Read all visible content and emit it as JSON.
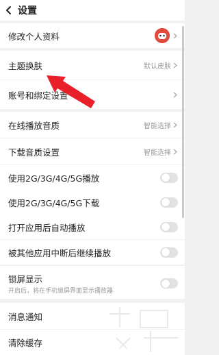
{
  "header": {
    "title": "设置",
    "back_icon": "back-arrow-icon"
  },
  "rows": [
    {
      "label": "修改个人资料",
      "value": "",
      "type": "avatar"
    },
    {
      "label": "主题换肤",
      "value": "默认皮肤",
      "type": "chevron"
    },
    {
      "label": "账号和绑定设置",
      "value": "",
      "type": "chevron"
    },
    {
      "label": "在线播放音质",
      "value": "智能选择",
      "type": "chevron"
    },
    {
      "label": "下载音质设置",
      "value": "智能选择",
      "type": "chevron"
    },
    {
      "label": "使用2G/3G/4G/5G播放",
      "value": "",
      "type": "toggle",
      "on": false
    },
    {
      "label": "使用2G/3G/4G/5G下载",
      "value": "",
      "type": "toggle",
      "on": false
    },
    {
      "label": "打开应用后自动播放",
      "value": "",
      "type": "toggle",
      "on": false
    },
    {
      "label": "被其他应用中断后继续播放",
      "value": "",
      "type": "toggle",
      "on": false
    },
    {
      "label": "锁屏显示",
      "sub": "开启后，将在手机锁屏界面显示播放器",
      "type": "toggle",
      "on": false
    },
    {
      "label": "消息通知",
      "value": "",
      "type": "chevron"
    },
    {
      "label": "清除缓存",
      "value": "",
      "type": "chevron"
    }
  ],
  "annotation": {
    "arrow_color": "#e8202a"
  },
  "colors": {
    "background": "#f1f1f1",
    "row": "#ffffff",
    "text": "#222222",
    "secondary": "#999999"
  }
}
